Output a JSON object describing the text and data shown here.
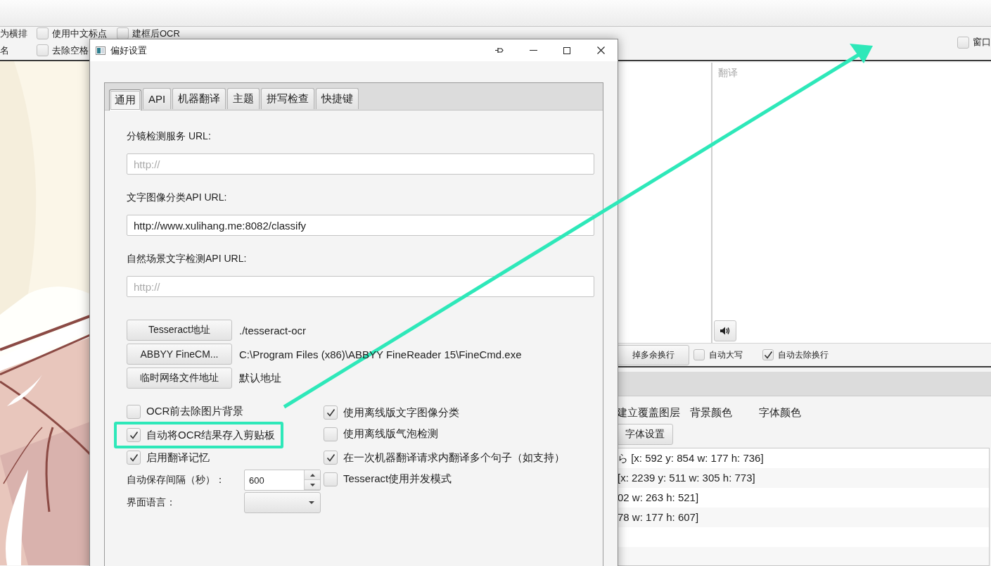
{
  "app": {
    "toolbar": {
      "left_labels": [
        "为横排",
        "名"
      ],
      "options": [
        {
          "label": "使用中文标点",
          "checked": false
        },
        {
          "label": "去除空格",
          "checked": false
        },
        {
          "label": "建框后OCR",
          "checked": false
        }
      ],
      "right_option": {
        "label": "窗口",
        "checked": false
      }
    },
    "translation": {
      "placeholder": "翻译"
    },
    "text_options": {
      "button": "掉多余换行",
      "options": [
        {
          "label": "自动大写",
          "checked": false
        },
        {
          "label": "自动去除换行",
          "checked": true
        }
      ]
    },
    "overlay": {
      "labels": [
        "建立覆盖图层",
        "背景颜色",
        "字体颜色"
      ],
      "button": "字体设置",
      "rows": [
        "ら [x: 592 y: 854 w: 177 h: 736]",
        "[x: 2239 y: 511 w: 305 h: 773]",
        "02 w: 263 h: 521]",
        "78 w: 177 h: 607]"
      ]
    }
  },
  "dialog": {
    "title": "偏好设置",
    "tabs": [
      {
        "label": "通用",
        "selected": true
      },
      {
        "label": "API",
        "selected": false
      },
      {
        "label": "机器翻译",
        "selected": false
      },
      {
        "label": "主题",
        "selected": false
      },
      {
        "label": "拼写检查",
        "selected": false
      },
      {
        "label": "快捷键",
        "selected": false
      }
    ],
    "fields": [
      {
        "label": "分镜检测服务 URL:",
        "placeholder": "http://"
      },
      {
        "label": "文字图像分类API URL:",
        "value": "http://www.xulihang.me:8082/classify"
      },
      {
        "label": "自然场景文字检测API URL:",
        "placeholder": "http://"
      }
    ],
    "paths": [
      {
        "button": "Tesseract地址",
        "value": "./tesseract-ocr"
      },
      {
        "button": "ABBYY FineCM...",
        "value": "C:\\Program Files (x86)\\ABBYY FineReader 15\\FineCmd.exe"
      },
      {
        "button": "临时网络文件地址",
        "value": "默认地址"
      }
    ],
    "options": [
      {
        "kind": "checkbox",
        "label": "OCR前去除图片背景",
        "checked": false,
        "highlighted": false
      },
      {
        "kind": "checkbox",
        "label": "使用离线版文字图像分类",
        "checked": true,
        "highlighted": false
      },
      {
        "kind": "checkbox",
        "label": "自动将OCR结果存入剪贴板",
        "checked": true,
        "highlighted": true
      },
      {
        "kind": "checkbox",
        "label": "使用离线版气泡检测",
        "checked": false,
        "highlighted": false
      },
      {
        "kind": "checkbox",
        "label": "启用翻译记忆",
        "checked": true,
        "highlighted": false
      },
      {
        "kind": "checkbox",
        "label": "在一次机器翻译请求内翻译多个句子（如支持）",
        "checked": true,
        "highlighted": false
      },
      {
        "kind": "spinner",
        "label": "自动保存间隔（秒）：",
        "value": "600"
      },
      {
        "kind": "checkbox",
        "label": "Tesseract使用并发模式",
        "checked": false,
        "highlighted": false
      },
      {
        "kind": "combo",
        "label": "界面语言："
      }
    ]
  }
}
